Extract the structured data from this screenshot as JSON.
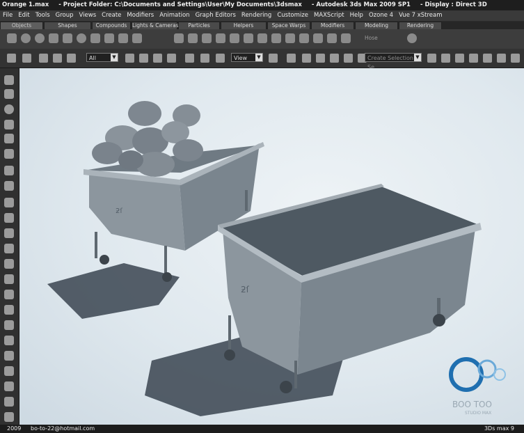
{
  "window": {
    "file": "Orange 1.max",
    "project": "- Project Folder: C:\\Documents and Settings\\User\\My Documents\\3dsmax",
    "app": "- Autodesk 3ds Max  2009 SP1",
    "display": "- Display : Direct 3D"
  },
  "menu": [
    "File",
    "Edit",
    "Tools",
    "Group",
    "Views",
    "Create",
    "Modifiers",
    "Animation",
    "Graph Editors",
    "Rendering",
    "Customize",
    "MAXScript",
    "Help",
    "Ozone 4",
    "Vue 7 xStream"
  ],
  "tabs": [
    "Objects",
    "Shapes",
    "Compounds",
    "Lights & Cameras",
    "Particles",
    "Helpers",
    "Space Warps",
    "Modifiers",
    "Modeling",
    "Rendering"
  ],
  "shelf": {
    "hose_label": "Hose"
  },
  "toolbar": {
    "selection_filter": "All",
    "reference_coord": "View",
    "named_selection_placeholder": "Create Selection Se"
  },
  "viewport": {
    "logo_text": "BOO TOO",
    "logo_sub": "STUDIO MAX",
    "accent": "#1f6fb0"
  },
  "status": {
    "year": "2009",
    "email": "bo-to-22@hotmail.com",
    "version": "3Ds max 9"
  }
}
